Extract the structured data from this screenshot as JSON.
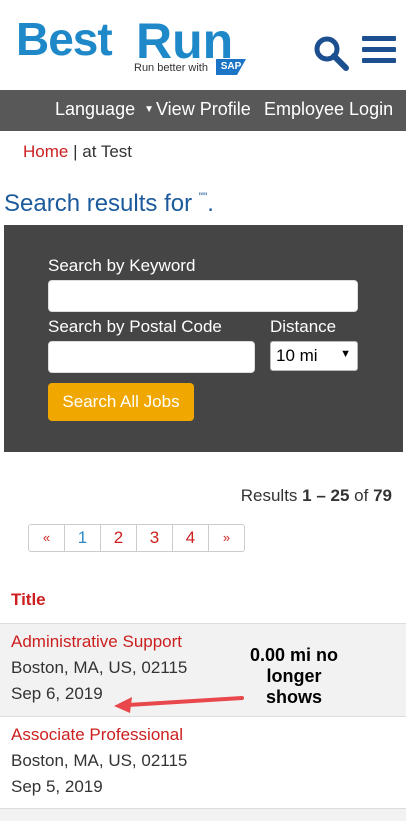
{
  "logo": {
    "best": "Best",
    "run": "Run",
    "tagline": "Run better with",
    "sap": "SAP"
  },
  "header": {
    "search_icon": "search-icon",
    "menu_icon": "hamburger-menu-icon"
  },
  "nav": {
    "language": "Language",
    "view_profile": "View Profile",
    "employee_login": "Employee Login"
  },
  "breadcrumb": {
    "home": "Home",
    "separator": " | ",
    "current": "at Test"
  },
  "results_title": {
    "text": "Search results for",
    "query": "\"\"",
    "period": "."
  },
  "search": {
    "keyword_label": "Search by Keyword",
    "keyword_value": "",
    "postal_label": "Search by Postal Code",
    "postal_value": "",
    "distance_label": "Distance",
    "distance_value": "10 mi",
    "button_label": "Search All Jobs"
  },
  "results_count": {
    "prefix": "Results",
    "range": "1 – 25",
    "of": "of",
    "total": "79"
  },
  "pagination": {
    "prev": "«",
    "pages": [
      "1",
      "2",
      "3",
      "4"
    ],
    "next": "»",
    "active_page": "1"
  },
  "table": {
    "column_title": "Title",
    "rows": [
      {
        "title": "Administrative Support",
        "location": "Boston, MA, US, 02115",
        "date": "Sep 6, 2019"
      },
      {
        "title": "Associate Professional",
        "location": "Boston, MA, US, 02115",
        "date": "Sep 5, 2019"
      }
    ]
  },
  "annotation": {
    "text": "0.00 mi no longer shows",
    "color": "#e8484c"
  },
  "colors": {
    "brand_blue": "#1e88c8",
    "link_red": "#cc1f1f",
    "button_orange": "#f0a800",
    "nav_gray": "#585858",
    "panel_gray": "#454545"
  }
}
